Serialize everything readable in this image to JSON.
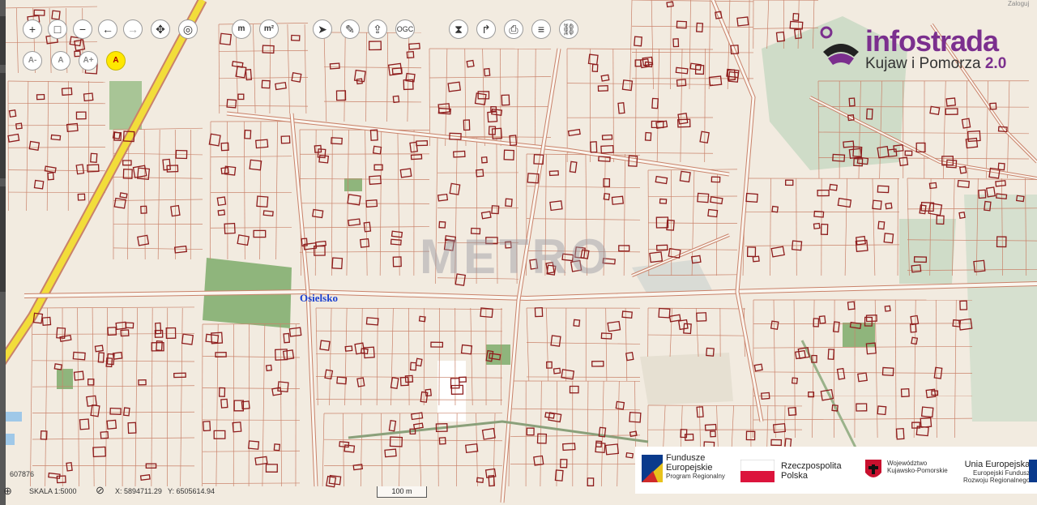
{
  "toolbar": {
    "zoom_in_icon": "+",
    "zoom_box_icon": "□",
    "zoom_out_icon": "−",
    "back_icon": "←",
    "forward_icon": "→",
    "pan_icon": "✥",
    "locate_icon": "◎",
    "measure_length_label": "m",
    "measure_area_label": "m²",
    "select_icon": "➤",
    "draw_icon": "✎",
    "export_icon": "⇪",
    "ogc_label": "OGC",
    "clear_icon": "⧗",
    "share_icon": "↱",
    "print_icon": "⎙",
    "layers_icon": "≡",
    "link_icon": "⛓",
    "font_smaller_label": "A-",
    "font_normal_label": "A",
    "font_larger_label": "A+",
    "font_contrast_label": "A"
  },
  "map": {
    "place_label": "Osielsko",
    "watermark": "METRO",
    "colors": {
      "background": "#f2ebe0",
      "parcel_line": "#c9826a",
      "building": "#8e1d1d",
      "green": "#9fbd8c",
      "road_major": "#f2dd3a",
      "forest": "#cfdcc8"
    }
  },
  "logo": {
    "title": "infostrada",
    "subtitle": "Kujaw i Pomorza",
    "version": "2.0"
  },
  "funding": {
    "fe_title": "Fundusze",
    "fe_title2": "Europejskie",
    "fe_sub": "Program Regionalny",
    "rp_title": "Rzeczpospolita",
    "rp_title2": "Polska",
    "wk_title": "Województwo",
    "wk_title2": "Kujawsko-Pomorskie",
    "ue_title": "Unia Europejska",
    "ue_sub": "Europejski Fundusz",
    "ue_sub2": "Rozwoju Regionalnego"
  },
  "status": {
    "left_code": "607876",
    "scale": "SKALA 1:5000",
    "coord_x": "X: 5894711.29",
    "coord_y": "Y: 6505614.94",
    "scalebar": "100 m"
  },
  "corner_text": "Zaloguj"
}
